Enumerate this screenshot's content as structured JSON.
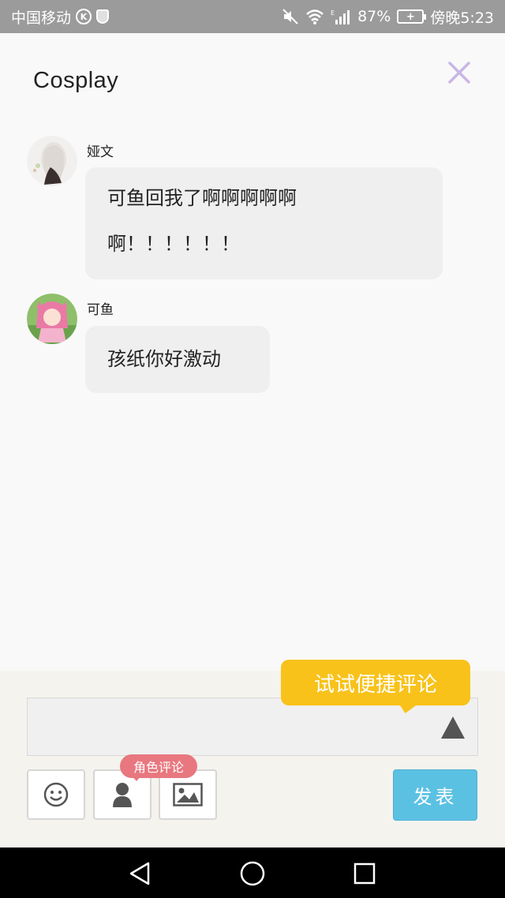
{
  "status_bar": {
    "carrier": "中国移动",
    "k_badge": "K",
    "battery_percent": "87%",
    "time": "傍晚5:23"
  },
  "header": {
    "title": "Cosplay",
    "close_icon": "close-icon"
  },
  "messages": [
    {
      "username": "娅文",
      "lines": [
        "可鱼回我了啊啊啊啊啊",
        "啊！！！！！！"
      ]
    },
    {
      "username": "可鱼",
      "lines": [
        "孩纸你好激动"
      ]
    }
  ],
  "composer": {
    "quick_comment_tip": "试试便捷评论",
    "role_comment_tip": "角色评论",
    "publish_label": "发表",
    "tools": [
      "emoji-icon",
      "person-icon",
      "image-icon"
    ]
  },
  "colors": {
    "accent_blue": "#5bc1e3",
    "tip_yellow": "#f8c21a",
    "tip_pink": "#e8777f",
    "close_purple": "#c9b6e6"
  }
}
